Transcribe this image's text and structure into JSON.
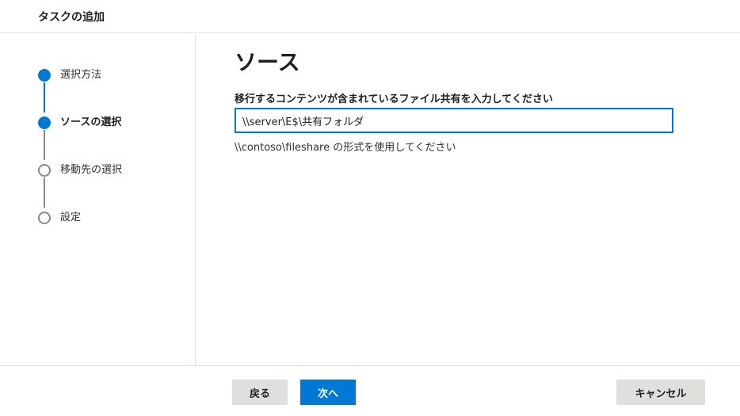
{
  "header": {
    "title": "タスクの追加"
  },
  "steps": [
    {
      "label": "選択方法",
      "state": "done"
    },
    {
      "label": "ソースの選択",
      "state": "current"
    },
    {
      "label": "移動先の選択",
      "state": "pending"
    },
    {
      "label": "設定",
      "state": "pending"
    }
  ],
  "main": {
    "title": "ソース",
    "field_label": "移行するコンテンツが含まれているファイル共有を入力してください",
    "input_value": "\\\\server\\E$\\共有フォルダ",
    "hint": "\\\\contoso\\fileshare の形式を使用してください"
  },
  "footer": {
    "back_label": "戻る",
    "next_label": "次へ",
    "cancel_label": "キャンセル"
  },
  "colors": {
    "accent": "#0078d4",
    "inactive_line": "#8a8886",
    "divider": "#e1dfdd"
  }
}
